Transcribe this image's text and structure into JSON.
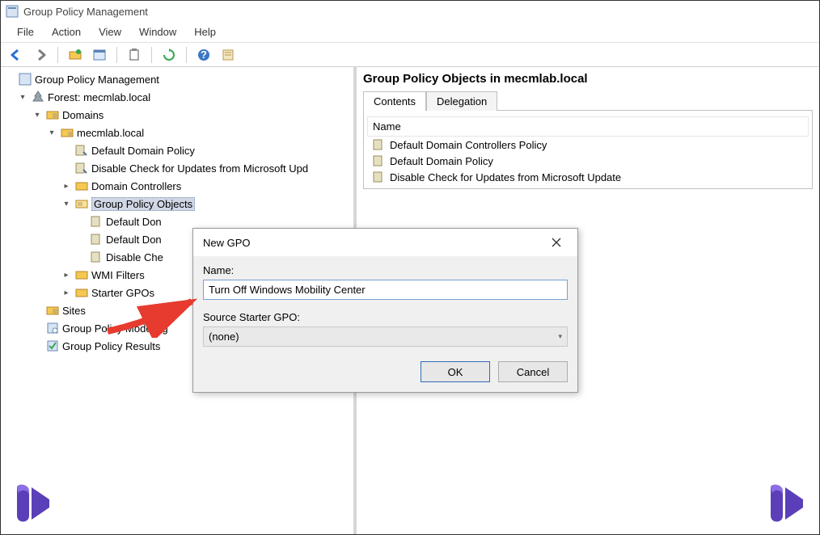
{
  "window": {
    "title": "Group Policy Management"
  },
  "menu": {
    "file": "File",
    "action": "Action",
    "view": "View",
    "window": "Window",
    "help": "Help"
  },
  "tree": {
    "root": "Group Policy Management",
    "forest": "Forest: mecmlab.local",
    "domains": "Domains",
    "domain": "mecmlab.local",
    "ddp": "Default Domain Policy",
    "disableCheck": "Disable Check for Updates from Microsoft Upd",
    "dcs": "Domain Controllers",
    "gpo": "Group Policy Objects",
    "gpo_items": {
      "ddcp": "Default Don",
      "ddp2": "Default Don",
      "disable2": "Disable Che"
    },
    "wmi": "WMI Filters",
    "starter": "Starter GPOs",
    "sites": "Sites",
    "modeling": "Group Policy Modeling",
    "results": "Group Policy Results"
  },
  "right": {
    "header": "Group Policy Objects in mecmlab.local",
    "tabs": {
      "contents": "Contents",
      "delegation": "Delegation"
    },
    "col": "Name",
    "rows": [
      "Default Domain Controllers Policy",
      "Default Domain Policy",
      "Disable Check for Updates from Microsoft Update"
    ]
  },
  "dialog": {
    "title": "New GPO",
    "nameLabel": "Name:",
    "nameValue": "Turn Off Windows Mobility Center",
    "starterLabel": "Source Starter GPO:",
    "starterValue": "(none)",
    "ok": "OK",
    "cancel": "Cancel"
  },
  "icons": {
    "back": "back-arrow",
    "fwd": "forward-arrow",
    "folder": "folder",
    "refresh": "refresh",
    "window": "window",
    "clip": "clipboard",
    "help": "help",
    "props": "properties"
  }
}
